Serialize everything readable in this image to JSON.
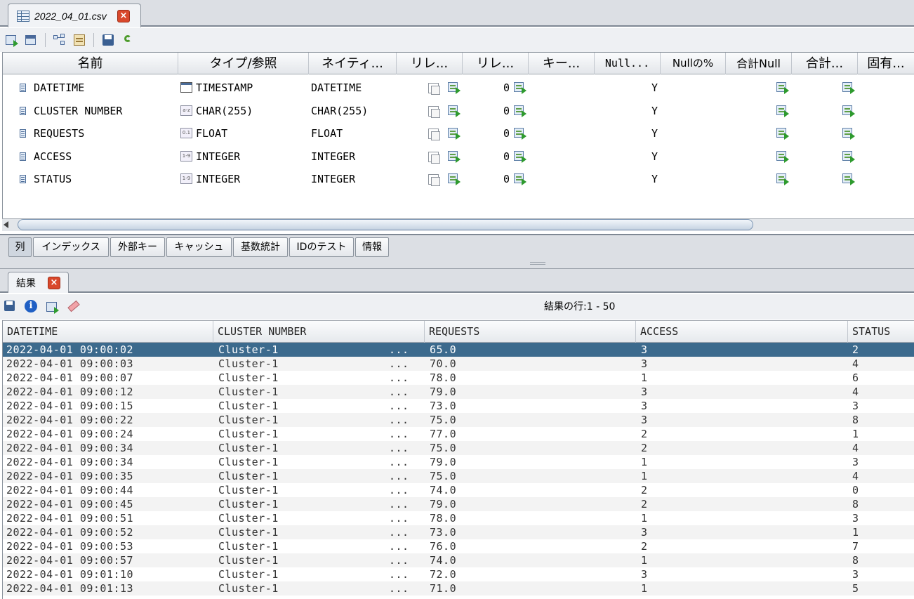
{
  "file_tab": {
    "title": "2022_04_01.csv",
    "icon": "table-icon",
    "close_icon": "close-icon"
  },
  "toolbar": {
    "icons": [
      "export-icon",
      "table-view-icon",
      "er-diagram-icon",
      "properties-icon",
      "save-icon",
      "refresh-icon"
    ]
  },
  "columns": {
    "headers": [
      "名前",
      "タイプ/参照",
      "ネイティ...",
      "リレ...",
      "リレ...",
      "キー...",
      "Null...",
      "Nullの%",
      "合計Null",
      "合計...",
      "固有..."
    ],
    "rows": [
      {
        "name": "DATETIME",
        "type_icon": "timestamp-icon",
        "type": "TIMESTAMP",
        "native": "DATETIME",
        "rel_count": "0",
        "nullable": "Y"
      },
      {
        "name": "CLUSTER NUMBER",
        "type_icon": "char-icon",
        "type_icon_text": "a-z",
        "type": "CHAR(255)",
        "native": "CHAR(255)",
        "rel_count": "0",
        "nullable": "Y"
      },
      {
        "name": "REQUESTS",
        "type_icon": "float-icon",
        "type_icon_text": "0.1",
        "type": "FLOAT",
        "native": "FLOAT",
        "rel_count": "0",
        "nullable": "Y"
      },
      {
        "name": "ACCESS",
        "type_icon": "integer-icon",
        "type_icon_text": "1-9",
        "type": "INTEGER",
        "native": "INTEGER",
        "rel_count": "0",
        "nullable": "Y"
      },
      {
        "name": "STATUS",
        "type_icon": "integer-icon",
        "type_icon_text": "1-9",
        "type": "INTEGER",
        "native": "INTEGER",
        "rel_count": "0",
        "nullable": "Y"
      }
    ]
  },
  "detail_tabs": [
    "列",
    "インデックス",
    "外部キー",
    "キャッシュ",
    "基数統計",
    "IDのテスト",
    "情報"
  ],
  "results_tab": {
    "title": "結果",
    "close_icon": "close-icon"
  },
  "results_toolbar": {
    "icons": [
      "save-icon",
      "info-icon",
      "export-results-icon",
      "eraser-icon"
    ],
    "count_text": "結果の行:1 - 50"
  },
  "results": {
    "headers": [
      "DATETIME",
      "CLUSTER NUMBER",
      "REQUESTS",
      "ACCESS",
      "STATUS"
    ],
    "ellipsis": "...",
    "rows": [
      [
        "2022-04-01 09:00:02",
        "Cluster-1",
        "65.0",
        "3",
        "2"
      ],
      [
        "2022-04-01 09:00:03",
        "Cluster-1",
        "70.0",
        "3",
        "4"
      ],
      [
        "2022-04-01 09:00:07",
        "Cluster-1",
        "78.0",
        "1",
        "6"
      ],
      [
        "2022-04-01 09:00:12",
        "Cluster-1",
        "79.0",
        "3",
        "4"
      ],
      [
        "2022-04-01 09:00:15",
        "Cluster-1",
        "73.0",
        "3",
        "3"
      ],
      [
        "2022-04-01 09:00:22",
        "Cluster-1",
        "75.0",
        "3",
        "8"
      ],
      [
        "2022-04-01 09:00:24",
        "Cluster-1",
        "77.0",
        "2",
        "1"
      ],
      [
        "2022-04-01 09:00:34",
        "Cluster-1",
        "75.0",
        "2",
        "4"
      ],
      [
        "2022-04-01 09:00:34",
        "Cluster-1",
        "79.0",
        "1",
        "3"
      ],
      [
        "2022-04-01 09:00:35",
        "Cluster-1",
        "75.0",
        "1",
        "4"
      ],
      [
        "2022-04-01 09:00:44",
        "Cluster-1",
        "74.0",
        "2",
        "0"
      ],
      [
        "2022-04-01 09:00:45",
        "Cluster-1",
        "79.0",
        "2",
        "8"
      ],
      [
        "2022-04-01 09:00:51",
        "Cluster-1",
        "78.0",
        "1",
        "3"
      ],
      [
        "2022-04-01 09:00:52",
        "Cluster-1",
        "73.0",
        "3",
        "1"
      ],
      [
        "2022-04-01 09:00:53",
        "Cluster-1",
        "76.0",
        "2",
        "7"
      ],
      [
        "2022-04-01 09:00:57",
        "Cluster-1",
        "74.0",
        "1",
        "8"
      ],
      [
        "2022-04-01 09:01:10",
        "Cluster-1",
        "72.0",
        "3",
        "3"
      ],
      [
        "2022-04-01 09:01:13",
        "Cluster-1",
        "71.0",
        "1",
        "5"
      ]
    ]
  }
}
